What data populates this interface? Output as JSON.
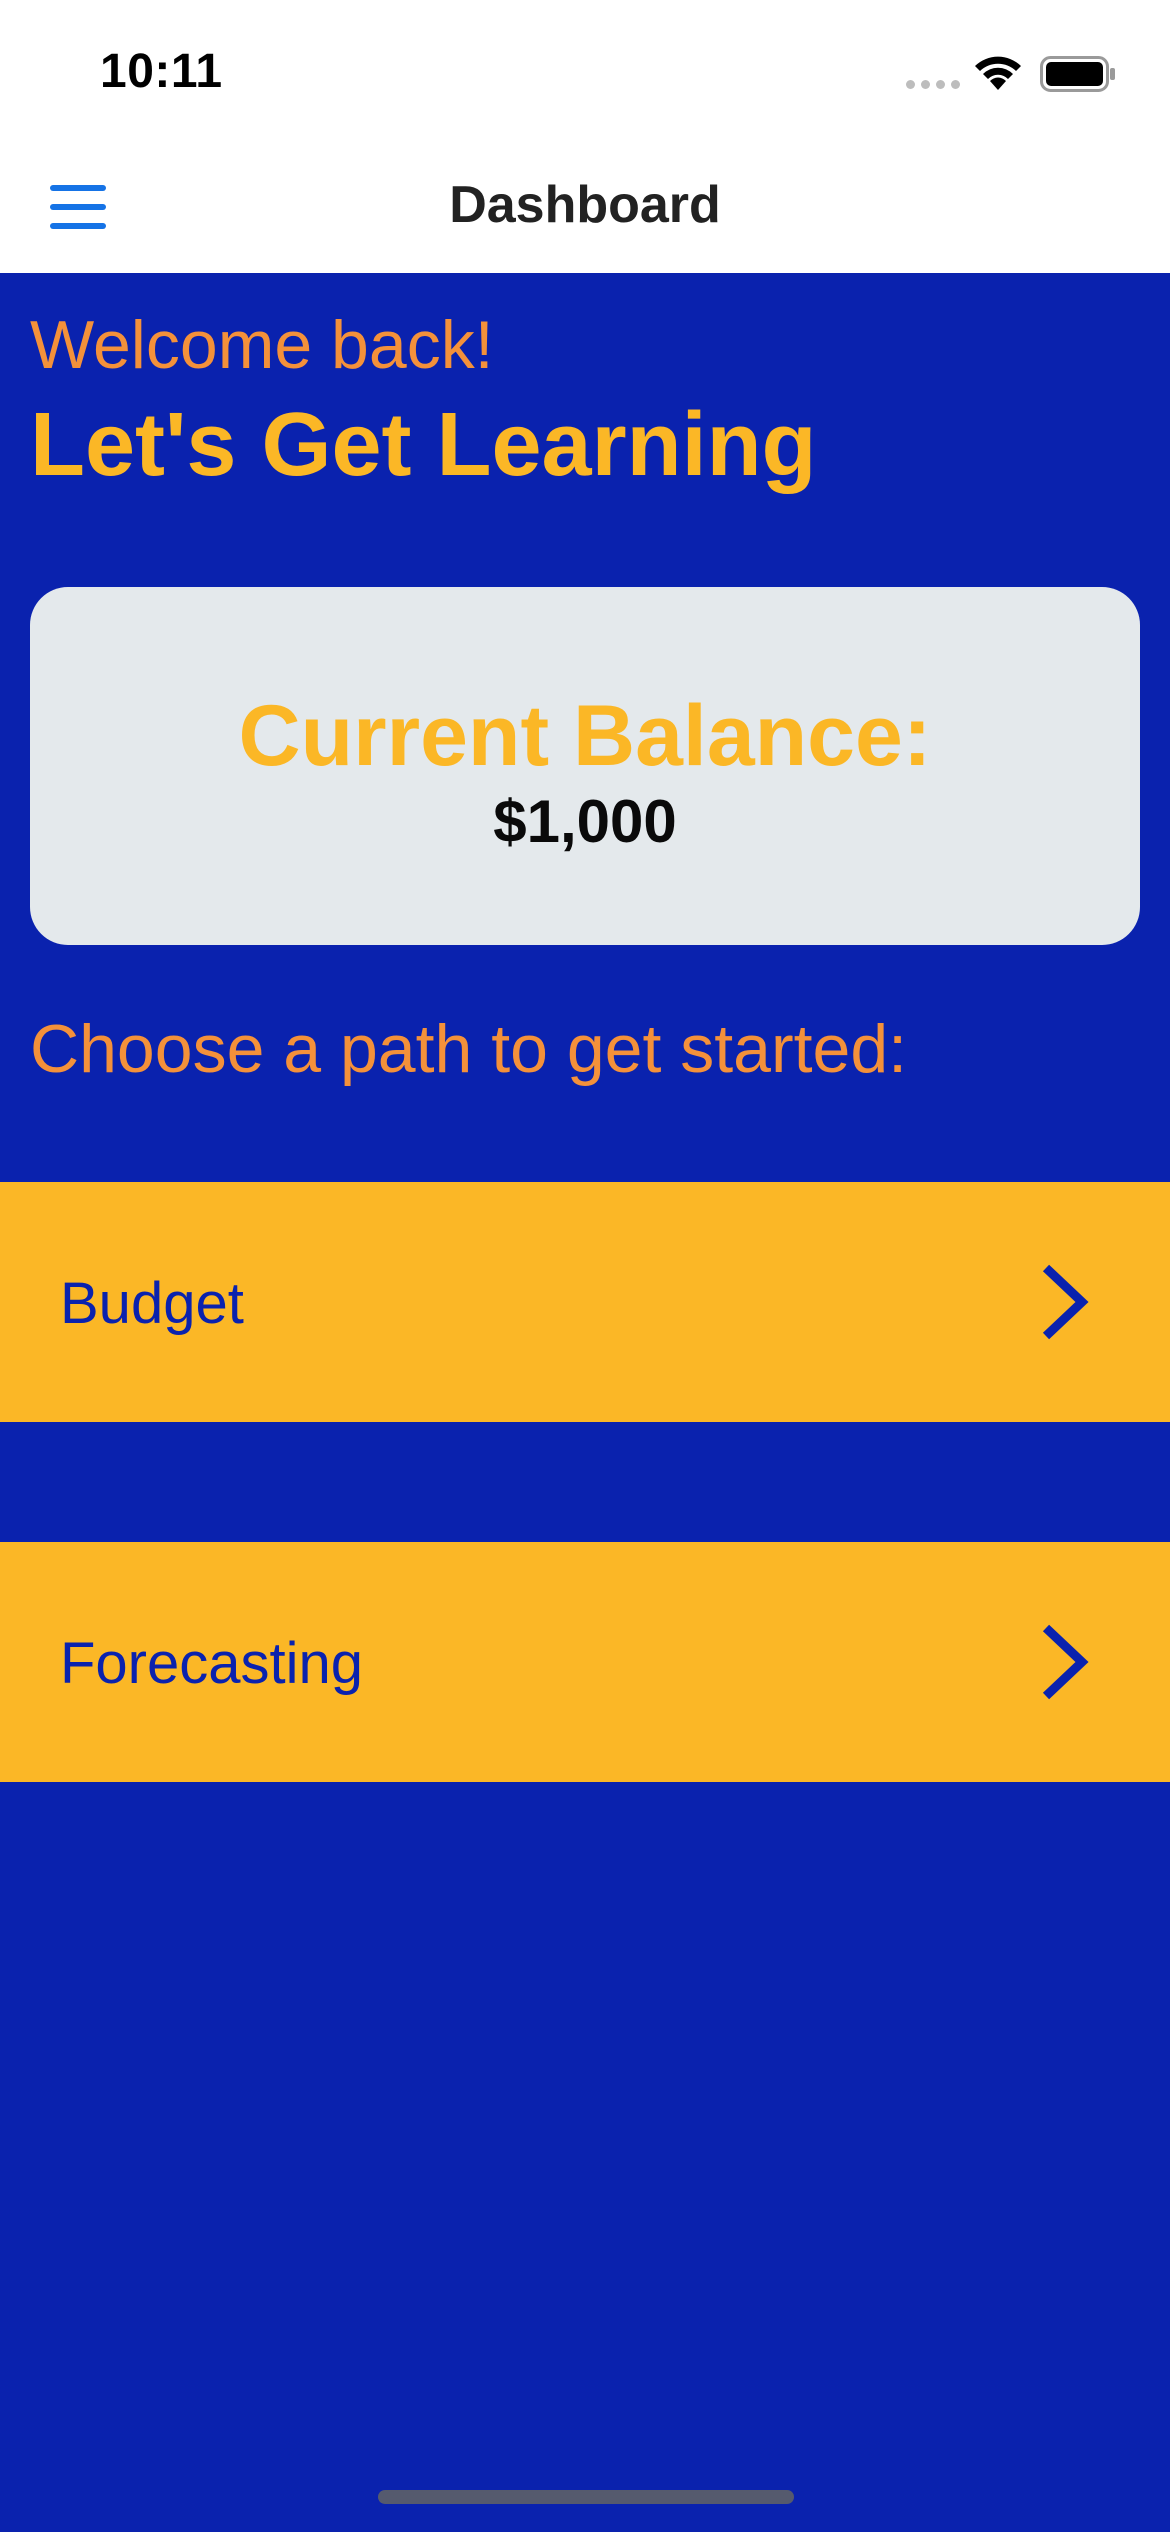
{
  "status_bar": {
    "time": "10:11"
  },
  "nav": {
    "title": "Dashboard",
    "menu_icon": "hamburger-menu-icon"
  },
  "welcome": {
    "greeting": "Welcome back!",
    "headline": "Let's Get Learning"
  },
  "balance": {
    "label": "Current Balance:",
    "value": "$1,000"
  },
  "paths": {
    "prompt": "Choose a path to get started:",
    "items": [
      {
        "label": "Budget",
        "icon": "chevron-right-icon"
      },
      {
        "label": "Forecasting",
        "icon": "chevron-right-icon"
      }
    ]
  },
  "colors": {
    "background": "#0a22ae",
    "accent_yellow": "#fbb726",
    "accent_orange": "#f4913a",
    "card": "#e4e9ec",
    "menu_blue": "#1573e6"
  }
}
